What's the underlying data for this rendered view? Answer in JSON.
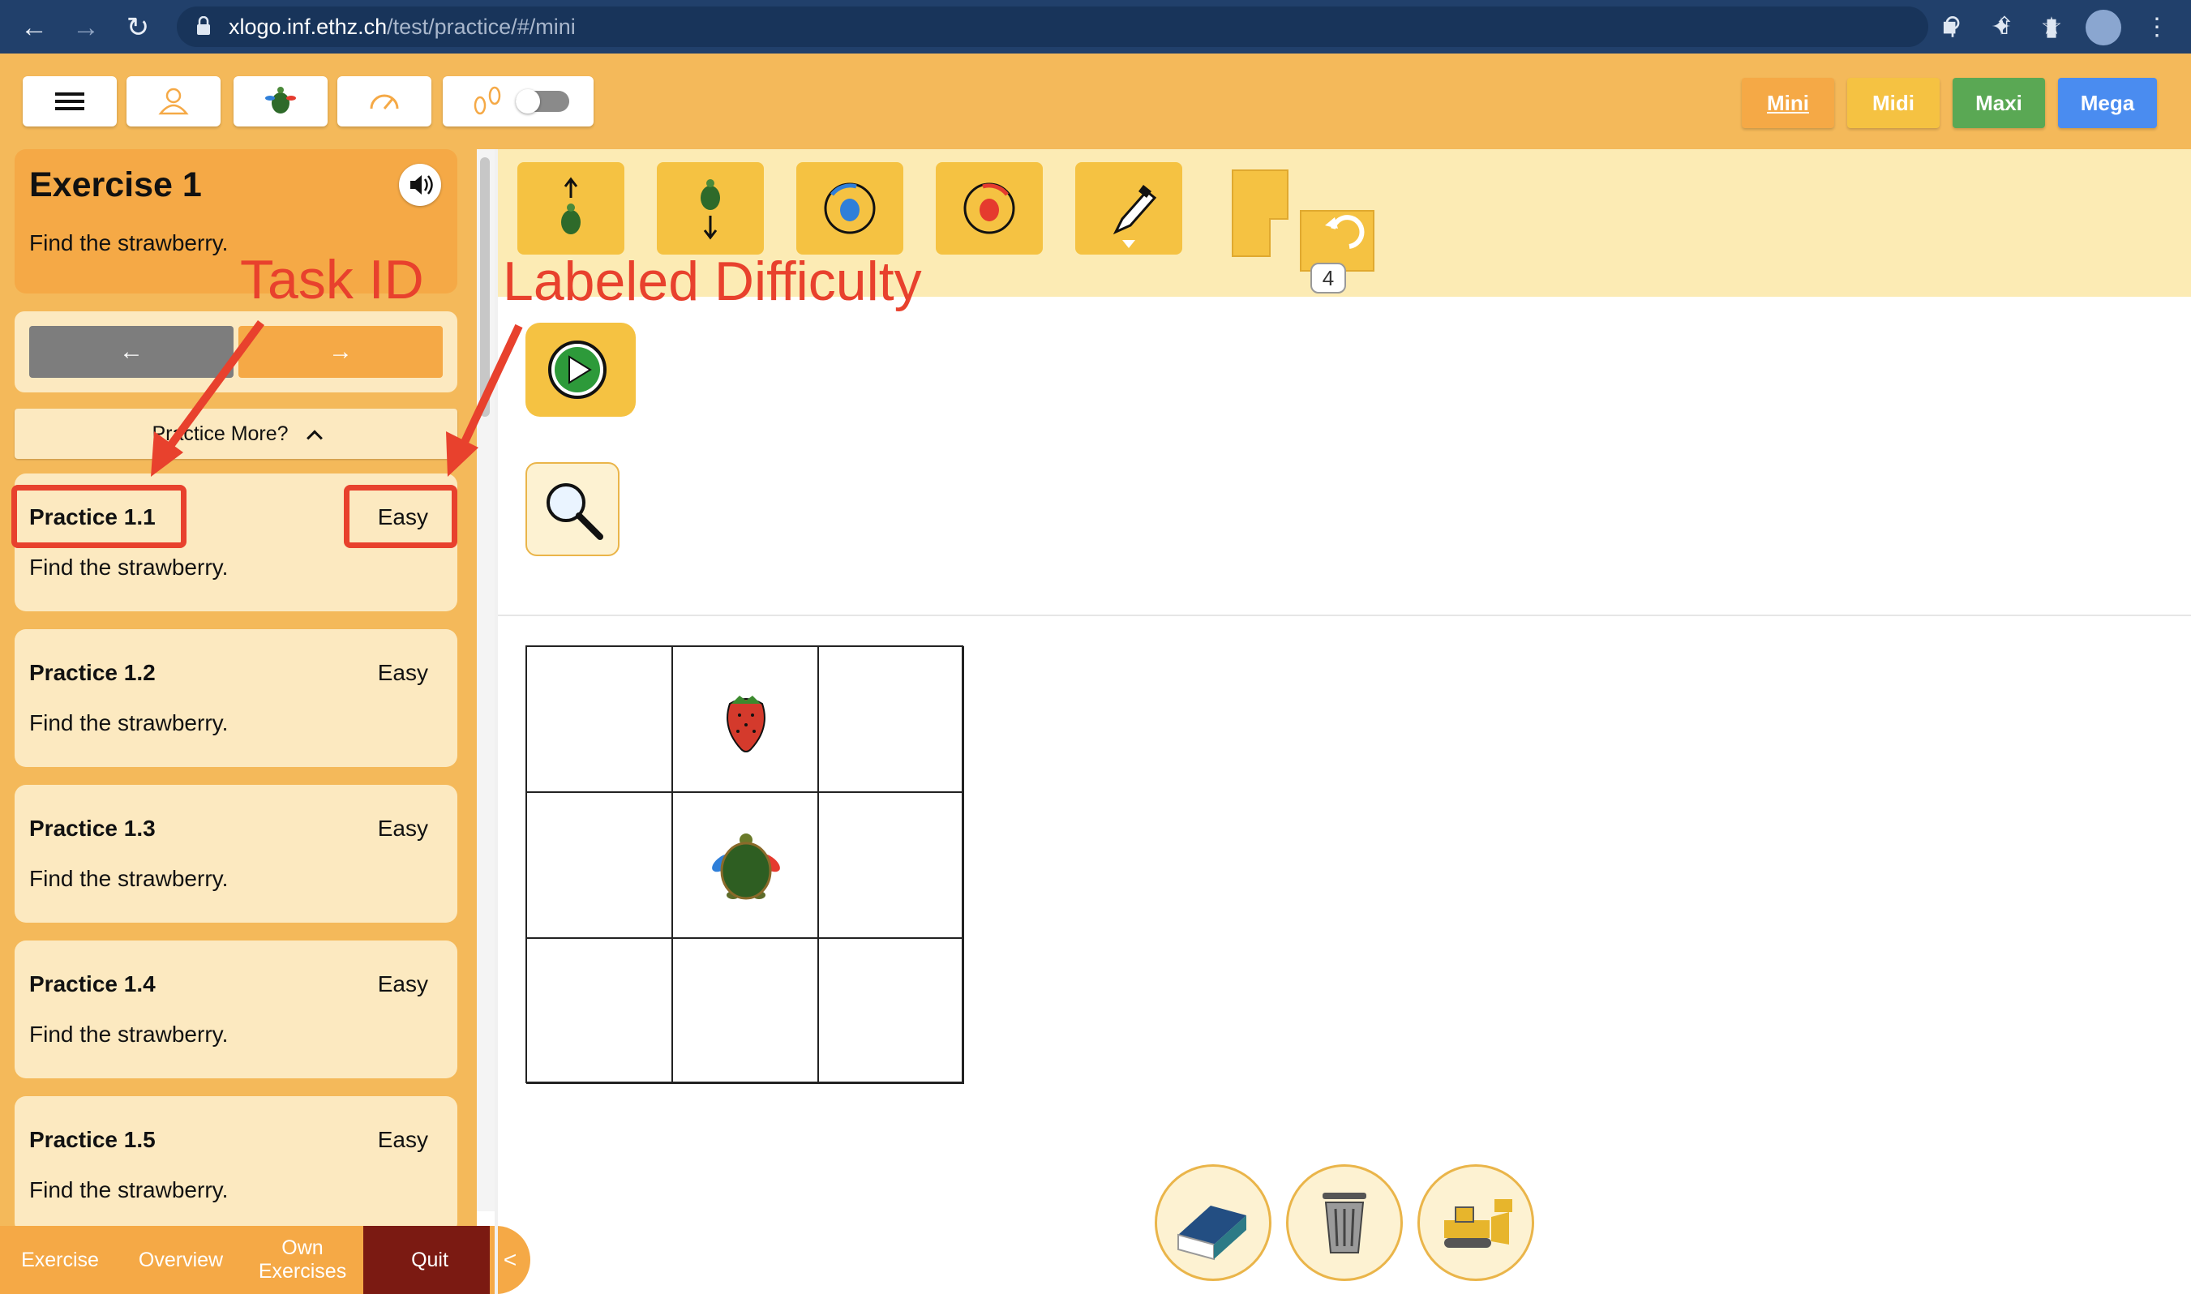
{
  "browser": {
    "url_host": "xlogo.inf.ethz.ch",
    "url_path": "/test/practice/#/mini"
  },
  "levels": [
    {
      "label": "Mini",
      "color": "#f5a946"
    },
    {
      "label": "Midi",
      "color": "#f5c242"
    },
    {
      "label": "Maxi",
      "color": "#5aa854"
    },
    {
      "label": "Mega",
      "color": "#4a8cf0"
    }
  ],
  "exercise": {
    "title": "Exercise 1",
    "description": "Find the strawberry."
  },
  "nav": {
    "prev_label": "←",
    "next_label": "→",
    "practice_more_label": "Practice More?"
  },
  "practice_items": [
    {
      "title": "Practice 1.1",
      "difficulty": "Easy",
      "description": "Find the strawberry."
    },
    {
      "title": "Practice 1.2",
      "difficulty": "Easy",
      "description": "Find the strawberry."
    },
    {
      "title": "Practice 1.3",
      "difficulty": "Easy",
      "description": "Find the strawberry."
    },
    {
      "title": "Practice 1.4",
      "difficulty": "Easy",
      "description": "Find the strawberry."
    },
    {
      "title": "Practice 1.5",
      "difficulty": "Easy",
      "description": "Find the strawberry."
    }
  ],
  "bottom_nav": {
    "exercise": "Exercise",
    "overview": "Overview",
    "own_exercises": "Own Exercises",
    "quit": "Quit",
    "collapse": "<"
  },
  "palette": {
    "repeat_count": "4"
  },
  "annotations": {
    "task_id": "Task ID",
    "labeled_difficulty": "Labeled Difficulty"
  },
  "colors": {
    "accent_orange": "#f4b95a",
    "card_orange": "#f5a946",
    "card_light": "#fce9c0",
    "block_yellow": "#f5c242",
    "annotation_red": "#e8412d",
    "quit_dark": "#7b1a12"
  }
}
